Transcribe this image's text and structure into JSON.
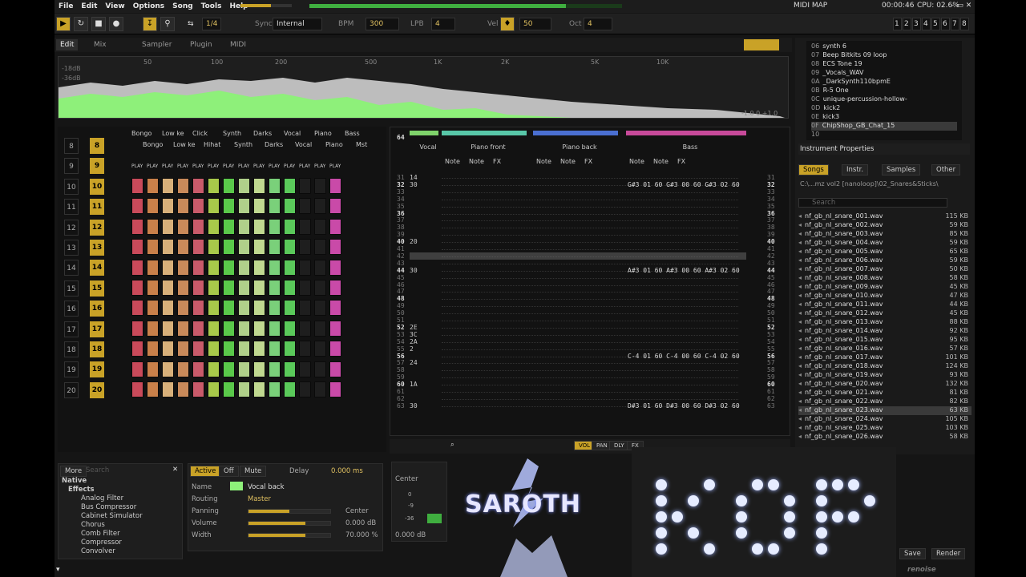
{
  "menu": [
    "File",
    "Edit",
    "View",
    "Options",
    "Song",
    "Tools",
    "Help"
  ],
  "status": {
    "midi_map": "MIDI MAP",
    "time": "00:00:46",
    "cpu": "CPU: 02.6%"
  },
  "transport": {
    "step": "1/4",
    "sync_label": "Sync",
    "sync_value": "Internal",
    "bpm_label": "BPM",
    "bpm": "300",
    "lpb_label": "LPB",
    "lpb": "4",
    "vel_label": "Vel",
    "vel": "50",
    "oct_label": "Oct",
    "oct": "4",
    "tracks": [
      "1",
      "2",
      "3",
      "4",
      "5",
      "6",
      "7",
      "8"
    ]
  },
  "view_tabs": [
    "Edit",
    "Mix",
    "Sampler",
    "Plugin",
    "MIDI"
  ],
  "spectrum": {
    "freqs": [
      "50",
      "100",
      "200",
      "500",
      "1K",
      "2K",
      "5K",
      "10K"
    ],
    "db": [
      "-18dB",
      "-36dB"
    ],
    "readout": "-1.0 0 +1.0"
  },
  "matrix": {
    "tracks_top": [
      "Bongo",
      "Low ke",
      "Click",
      "Synth",
      "Darks",
      "Vocal",
      "Piano",
      "Bass"
    ],
    "tracks_bottom": [
      "Bongo",
      "Low ke",
      "Hihat",
      "Synth",
      "Darks",
      "Vocal",
      "Piano",
      "Mst"
    ],
    "play": "PLAY",
    "seq": [
      "8",
      "9",
      "10",
      "11",
      "12",
      "13",
      "14",
      "15",
      "16",
      "17",
      "18",
      "19",
      "20"
    ],
    "pat": [
      "8",
      "9",
      "10",
      "11",
      "12",
      "13",
      "14",
      "15",
      "16",
      "17",
      "18",
      "19",
      "20"
    ]
  },
  "pattern": {
    "lines": "64",
    "tracks": [
      {
        "name": "Vocal",
        "color": "#7fd36b"
      },
      {
        "name": "Piano front",
        "color": "#58c7a8"
      },
      {
        "name": "Piano back",
        "color": "#4a6fd1"
      },
      {
        "name": "Bass",
        "color": "#c84a9a"
      }
    ],
    "sub": [
      "Note",
      "Note",
      "FX"
    ],
    "rows": [
      "31",
      "32",
      "33",
      "34",
      "35",
      "36",
      "37",
      "38",
      "39",
      "40",
      "41",
      "42",
      "43",
      "44",
      "45",
      "46",
      "47",
      "48",
      "49",
      "50",
      "51",
      "52",
      "53",
      "54",
      "55",
      "56",
      "57",
      "58",
      "59",
      "60",
      "61",
      "62",
      "63"
    ],
    "vocal_vals": [
      "14",
      "30",
      "",
      "",
      "",
      "",
      "",
      "",
      "",
      "20",
      "",
      "",
      "",
      "30",
      "",
      "",
      "",
      "",
      "",
      "",
      "",
      "2E",
      "3C",
      "2A",
      "2",
      "",
      "24",
      "",
      "",
      "1A",
      "",
      "",
      "30"
    ],
    "bass_notes": {
      "32": "G#3 01 60 G#3 00 60 G#3 02 60",
      "44": "A#3 01 60 A#3 00 60 A#3 02 60",
      "56": "C-4 01 60 C-4 00 60 C-4 02 60",
      "63": "D#3 01 60 D#3 00 60 D#3 02 60"
    }
  },
  "instruments": [
    {
      "id": "06",
      "name": "synth 6"
    },
    {
      "id": "07",
      "name": "Beep Bitkits 09 loop"
    },
    {
      "id": "08",
      "name": "ECS Tone 19"
    },
    {
      "id": "09",
      "name": "_Vocals_WAV"
    },
    {
      "id": "0A",
      "name": "_DarkSynth110bpmE"
    },
    {
      "id": "0B",
      "name": "R-5 One"
    },
    {
      "id": "0C",
      "name": "unique-percussion-hollow-"
    },
    {
      "id": "0D",
      "name": "kick2"
    },
    {
      "id": "0E",
      "name": "kick3"
    },
    {
      "id": "0F",
      "name": "ChipShop_GB_Chat_15"
    },
    {
      "id": "10",
      "name": ""
    }
  ],
  "inst_props": "Instrument Properties",
  "browser": {
    "tabs": [
      "Songs",
      "Instr.",
      "Samples",
      "Other"
    ],
    "path": "C:\\...mz vol2 [nanoloop]\\02_Snares&Sticks\\",
    "search": "Search",
    "files": [
      {
        "name": "nf_gb_nl_snare_001.wav",
        "size": "115 KB"
      },
      {
        "name": "nf_gb_nl_snare_002.wav",
        "size": "59 KB"
      },
      {
        "name": "nf_gb_nl_snare_003.wav",
        "size": "85 KB"
      },
      {
        "name": "nf_gb_nl_snare_004.wav",
        "size": "59 KB"
      },
      {
        "name": "nf_gb_nl_snare_005.wav",
        "size": "65 KB"
      },
      {
        "name": "nf_gb_nl_snare_006.wav",
        "size": "59 KB"
      },
      {
        "name": "nf_gb_nl_snare_007.wav",
        "size": "50 KB"
      },
      {
        "name": "nf_gb_nl_snare_008.wav",
        "size": "58 KB"
      },
      {
        "name": "nf_gb_nl_snare_009.wav",
        "size": "45 KB"
      },
      {
        "name": "nf_gb_nl_snare_010.wav",
        "size": "47 KB"
      },
      {
        "name": "nf_gb_nl_snare_011.wav",
        "size": "44 KB"
      },
      {
        "name": "nf_gb_nl_snare_012.wav",
        "size": "45 KB"
      },
      {
        "name": "nf_gb_nl_snare_013.wav",
        "size": "88 KB"
      },
      {
        "name": "nf_gb_nl_snare_014.wav",
        "size": "92 KB"
      },
      {
        "name": "nf_gb_nl_snare_015.wav",
        "size": "95 KB"
      },
      {
        "name": "nf_gb_nl_snare_016.wav",
        "size": "57 KB"
      },
      {
        "name": "nf_gb_nl_snare_017.wav",
        "size": "101 KB"
      },
      {
        "name": "nf_gb_nl_snare_018.wav",
        "size": "124 KB"
      },
      {
        "name": "nf_gb_nl_snare_019.wav",
        "size": "93 KB"
      },
      {
        "name": "nf_gb_nl_snare_020.wav",
        "size": "132 KB"
      },
      {
        "name": "nf_gb_nl_snare_021.wav",
        "size": "81 KB"
      },
      {
        "name": "nf_gb_nl_snare_022.wav",
        "size": "82 KB"
      },
      {
        "name": "nf_gb_nl_snare_023.wav",
        "size": "63 KB"
      },
      {
        "name": "nf_gb_nl_snare_024.wav",
        "size": "105 KB"
      },
      {
        "name": "nf_gb_nl_snare_025.wav",
        "size": "103 KB"
      },
      {
        "name": "nf_gb_nl_snare_026.wav",
        "size": "58 KB"
      }
    ],
    "save": "Save",
    "render": "Render"
  },
  "fx_browser": {
    "more": "More",
    "search": "Search",
    "root": "Native",
    "group": "Effects",
    "items": [
      "Analog Filter",
      "Bus Compressor",
      "Cabinet Simulator",
      "Chorus",
      "Comb Filter",
      "Compressor",
      "Convolver"
    ]
  },
  "track_dsp": {
    "active": "Active",
    "off": "Off",
    "mute": "Mute",
    "delay_label": "Delay",
    "delay": "0.000 ms",
    "name_label": "Name",
    "name": "Vocal back",
    "routing_label": "Routing",
    "routing": "Master",
    "panning_label": "Panning",
    "panning": "Center",
    "panning_level": 0.5,
    "volume_label": "Volume",
    "volume": "0.000 dB",
    "volume_level": 0.7,
    "width_label": "Width",
    "width": "70.000 %",
    "width_level": 0.7
  },
  "meter": {
    "label": "Center",
    "scale": [
      "0",
      "-9",
      "-36"
    ],
    "db": "0.000 dB"
  },
  "bottom_tabs": [
    "VOL",
    "PAN",
    "DLY",
    "FX"
  ],
  "overlay": {
    "logo1": "SAROTH",
    "logo2": "KOP",
    "brand": "renoise"
  }
}
